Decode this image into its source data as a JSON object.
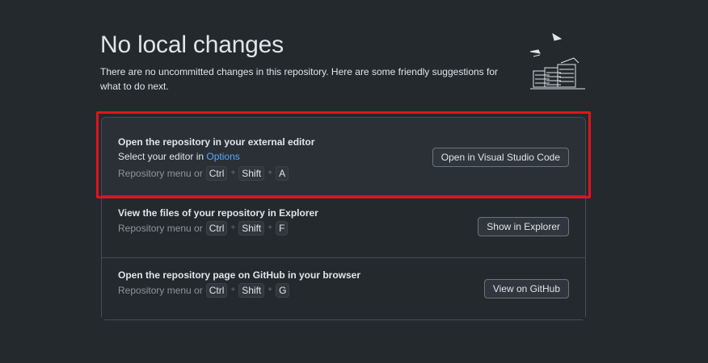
{
  "header": {
    "title": "No local changes",
    "subtitle": "There are no uncommitted changes in this repository. Here are some friendly suggestions for what to do next."
  },
  "illustration": {
    "icon": "paper-stacks-illustration-icon"
  },
  "cards": [
    {
      "title": "Open the repository in your external editor",
      "desc_prefix": "Select your editor in ",
      "desc_link": "Options",
      "shortcut_prefix": "Repository menu or",
      "keys": [
        "Ctrl",
        "Shift",
        "A"
      ],
      "button_label": "Open in Visual Studio Code"
    },
    {
      "title": "View the files of your repository in Explorer",
      "shortcut_prefix": "Repository menu or",
      "keys": [
        "Ctrl",
        "Shift",
        "F"
      ],
      "button_label": "Show in Explorer"
    },
    {
      "title": "Open the repository page on GitHub in your browser",
      "shortcut_prefix": "Repository menu or",
      "keys": [
        "Ctrl",
        "Shift",
        "G"
      ],
      "button_label": "View on GitHub"
    }
  ],
  "plus_sign": "+",
  "colors": {
    "background": "#24292e",
    "card_selected": "#2b3036",
    "link": "#58a6ff",
    "highlight": "#e3141a"
  }
}
